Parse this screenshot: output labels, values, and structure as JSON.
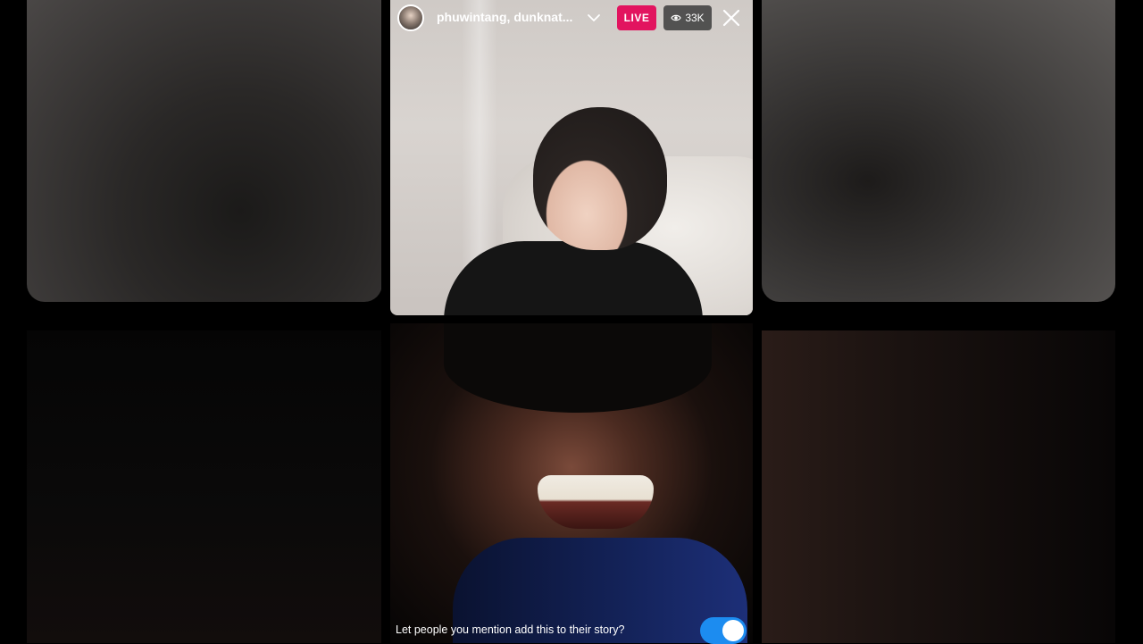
{
  "header": {
    "names": "phuwintang, dunknat...",
    "live_label": "LIVE",
    "viewer_count": "33K"
  },
  "footer": {
    "prompt_text": "Let people you mention add this to their story?",
    "toggle_on": true
  },
  "colors": {
    "live_badge": "#e2145f",
    "toggle_on": "#1c8cf0"
  },
  "icons": {
    "chevron": "chevron-down-icon",
    "viewers": "eye-icon",
    "close": "close-icon"
  }
}
